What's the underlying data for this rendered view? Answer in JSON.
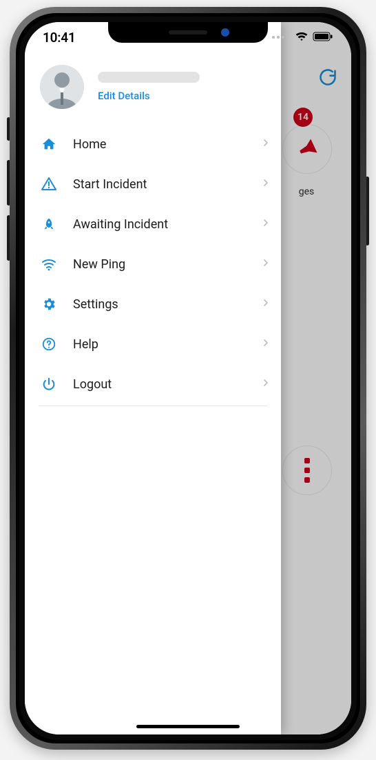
{
  "status": {
    "time": "10:41"
  },
  "profile": {
    "edit_label": "Edit Details"
  },
  "menu": {
    "home": "Home",
    "start_incident": "Start Incident",
    "awaiting_incident": "Awaiting Incident",
    "new_ping": "New Ping",
    "settings": "Settings",
    "help": "Help",
    "logout": "Logout"
  },
  "background": {
    "badge_count": "14",
    "card1_label_tail": "ges"
  },
  "colors": {
    "accent": "#1a8fd8",
    "danger": "#d0021b"
  }
}
